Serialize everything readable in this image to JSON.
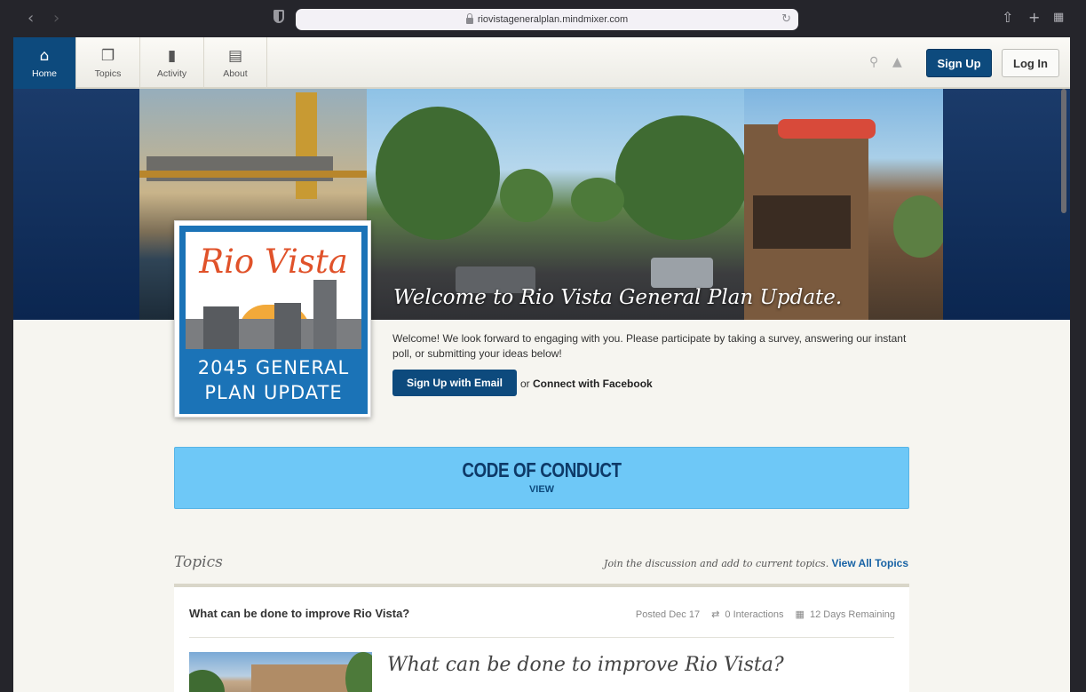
{
  "browser": {
    "url": "riovistageneralplan.mindmixer.com",
    "back_icon": "chevron-left-icon",
    "forward_icon": "chevron-right-icon"
  },
  "nav": {
    "items": [
      {
        "label": "Home",
        "icon": "home-icon"
      },
      {
        "label": "Topics",
        "icon": "topics-icon"
      },
      {
        "label": "Activity",
        "icon": "activity-icon"
      },
      {
        "label": "About",
        "icon": "document-icon"
      }
    ],
    "signup_label": "Sign Up",
    "login_label": "Log In"
  },
  "hero": {
    "welcome_title": "Welcome to Rio Vista General Plan Update.",
    "intro_text": "Welcome! We look forward to engaging with you. Please participate by taking a survey, answering our instant poll, or submitting your ideas below!",
    "email_button": "Sign Up with Email",
    "or_text": "or",
    "facebook_link": "Connect with Facebook"
  },
  "logo": {
    "script": "Rio Vista",
    "line1": "2045 GENERAL",
    "line2": "PLAN UPDATE"
  },
  "conduct": {
    "title": "CODE OF CONDUCT",
    "view_label": "VIEW"
  },
  "topics": {
    "heading": "Topics",
    "cta_text": "Join the discussion and add to current topics.",
    "view_all": "View All Topics",
    "card": {
      "title": "What can be done to improve Rio Vista?",
      "posted": "Posted Dec 17",
      "interactions": "0 Interactions",
      "remaining": "12 Days Remaining",
      "subtitle": "What can be done to improve Rio Vista?"
    }
  },
  "colors": {
    "primary": "#0d4a7d",
    "conduct_bg": "#6ec8f7",
    "hero_band": "#0b2650"
  }
}
